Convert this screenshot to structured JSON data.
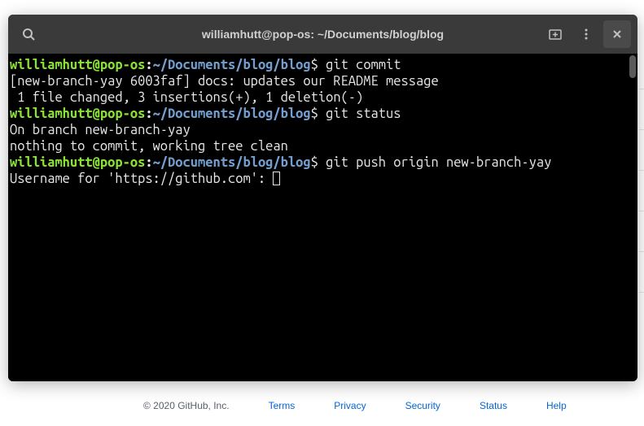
{
  "window": {
    "title": "williamhutt@pop-os: ~/Documents/blog/blog"
  },
  "prompt": {
    "user": "williamhutt@pop-os",
    "sep": ":",
    "path": "~/Documents/blog/blog",
    "symbol": "$"
  },
  "lines": {
    "cmd1": " git commit",
    "out1": "[new-branch-yay 6003faf] docs: updates our README message",
    "out2": " 1 file changed, 3 insertions(+), 1 deletion(-)",
    "cmd2": " git status",
    "out3": "On branch new-branch-yay",
    "out4": "nothing to commit, working tree clean",
    "cmd3": " git push origin new-branch-yay",
    "out5": "Username for 'https://github.com': "
  },
  "footer": {
    "copyright": "© 2020 GitHub, Inc.",
    "links": {
      "terms": "Terms",
      "privacy": "Privacy",
      "security": "Security",
      "status": "Status",
      "help": "Help"
    }
  }
}
